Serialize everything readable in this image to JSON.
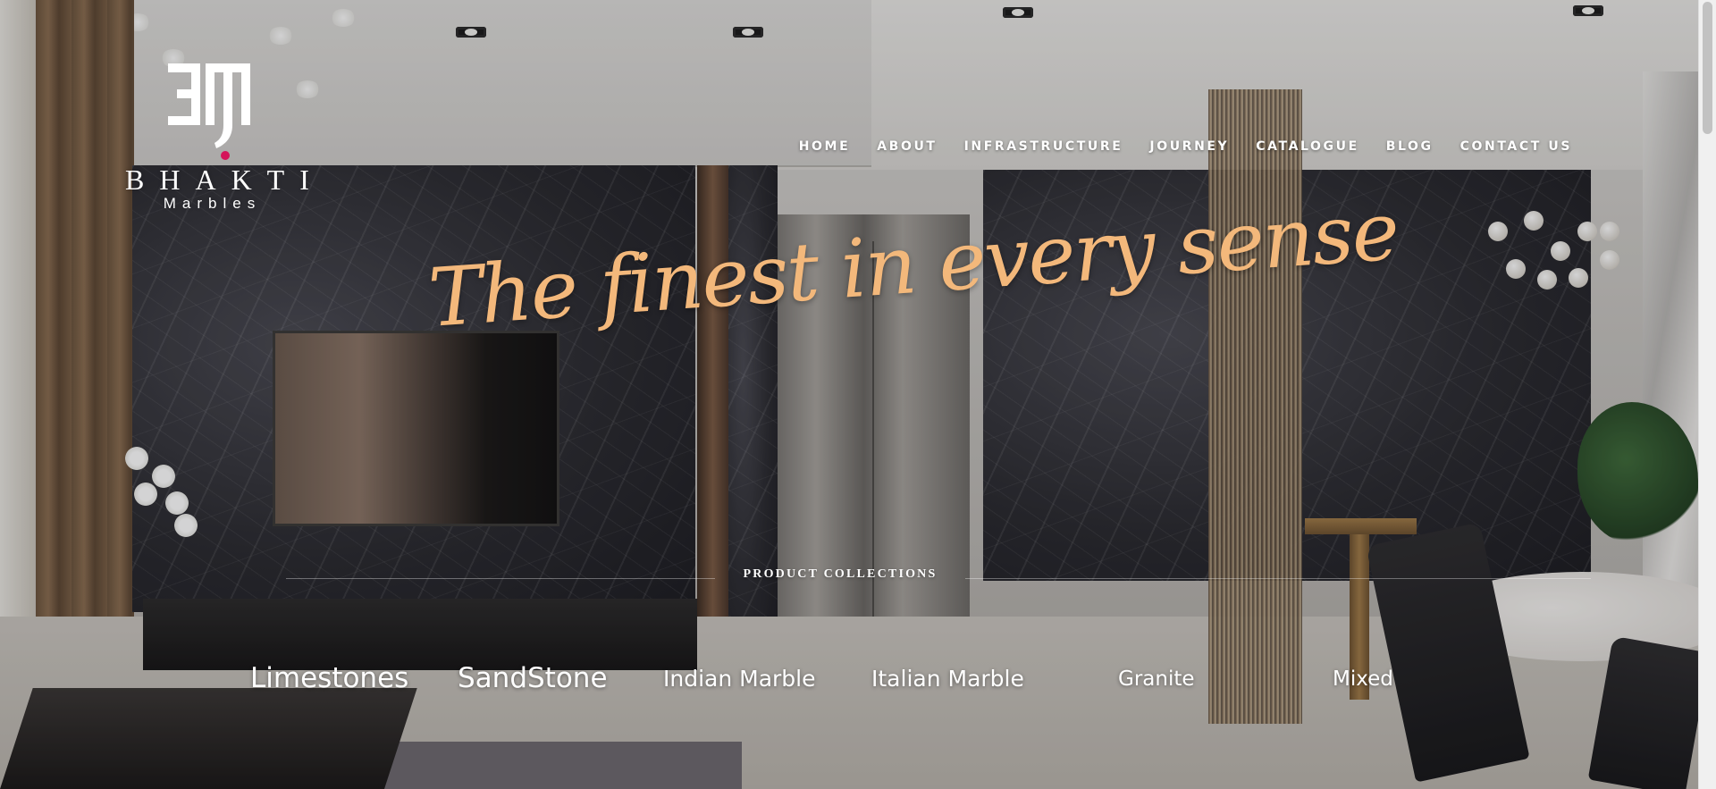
{
  "brand": {
    "name": "BHAKTI",
    "sub": "Marbles",
    "accent_color": "#d4145a"
  },
  "nav": {
    "items": [
      {
        "label": "HOME"
      },
      {
        "label": "ABOUT"
      },
      {
        "label": "INFRASTRUCTURE"
      },
      {
        "label": "JOURNEY"
      },
      {
        "label": "CATALOGUE"
      },
      {
        "label": "BLOG"
      },
      {
        "label": "CONTACT US"
      }
    ]
  },
  "hero": {
    "tagline": "The finest in every sense",
    "tagline_color": "#f3b87b"
  },
  "collections": {
    "title": "PRODUCT COLLECTIONS",
    "items": [
      {
        "label": "Limestones"
      },
      {
        "label": "SandStone"
      },
      {
        "label": "Indian Marble"
      },
      {
        "label": "Italian Marble"
      },
      {
        "label": "Granite"
      },
      {
        "label": "Mixed"
      }
    ]
  },
  "icons": {
    "logo": "bhakti-monogram-icon",
    "scroll": "scrollbar"
  }
}
